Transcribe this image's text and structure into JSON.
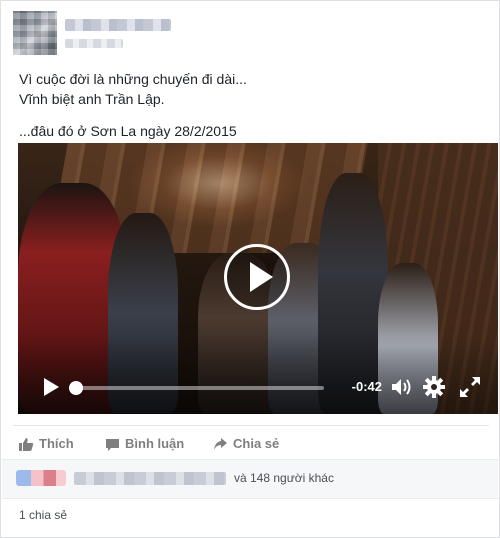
{
  "post": {
    "text_lines": [
      "Vì cuộc đời là những chuyến đi dài...",
      "Vĩnh biệt anh Trần Lập.",
      "...đâu đó ở Sơn La ngày 28/2/2015"
    ]
  },
  "video": {
    "time_remaining": "-0:42",
    "progress": 0.0,
    "icons": {
      "big_play": "play-circle-icon",
      "play": "play-icon",
      "volume": "volume-icon",
      "settings": "gear-icon",
      "fullscreen": "fullscreen-icon"
    }
  },
  "actions": {
    "like_label": "Thích",
    "comment_label": "Bình luận",
    "share_label": "Chia sẻ",
    "icons": {
      "like": "thumbs-up-icon",
      "comment": "comment-icon",
      "share": "share-arrow-icon"
    }
  },
  "reactions": {
    "others_text": "và 148 người khác"
  },
  "shares": {
    "text": "1 chia sẻ"
  },
  "colors": {
    "text": "#1d2129",
    "muted": "#7f7f7f",
    "secondary": "#4b4f56"
  }
}
